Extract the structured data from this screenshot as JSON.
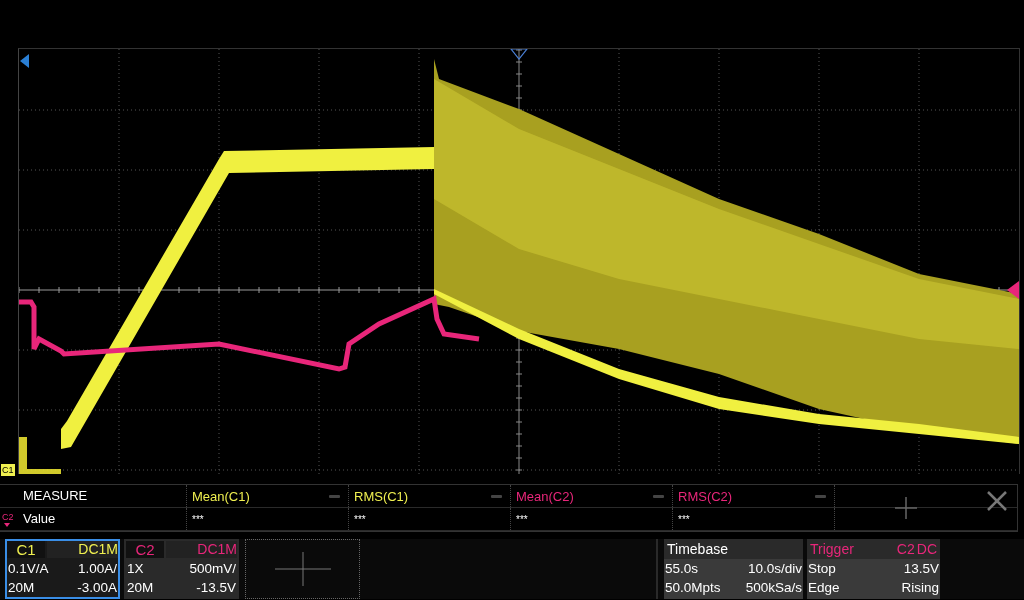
{
  "markers": {
    "c1_label": "C1",
    "c2_label": "C2"
  },
  "measure": {
    "title": "MEASURE",
    "row_label": "Value",
    "items": [
      {
        "name": "Mean(C1)",
        "value": "***",
        "color": "#f0f050"
      },
      {
        "name": "RMS(C1)",
        "value": "***",
        "color": "#f0f050"
      },
      {
        "name": "Mean(C2)",
        "value": "***",
        "color": "#e8267a"
      },
      {
        "name": "RMS(C2)",
        "value": "***",
        "color": "#e8267a"
      }
    ]
  },
  "channels": [
    {
      "name": "C1",
      "coupling": "DC1M",
      "probe": "0.1V/A",
      "scale": "1.00A/",
      "bandwidth": "20M",
      "offset": "-3.00A",
      "color": "#f0f050",
      "selected": true
    },
    {
      "name": "C2",
      "coupling": "DC1M",
      "probe": "1X",
      "scale": "500mV/",
      "bandwidth": "20M",
      "offset": "-13.5V",
      "color": "#e8267a",
      "selected": false
    }
  ],
  "timebase": {
    "title": "Timebase",
    "delay": "55.0s",
    "scale": "10.0s/div",
    "memory": "50.0Mpts",
    "rate": "500kSa/s"
  },
  "trigger": {
    "title": "Trigger",
    "source": "C2",
    "coupling": "DC",
    "mode": "Stop",
    "level": "13.5V",
    "type": "Edge",
    "slope": "Rising"
  }
}
